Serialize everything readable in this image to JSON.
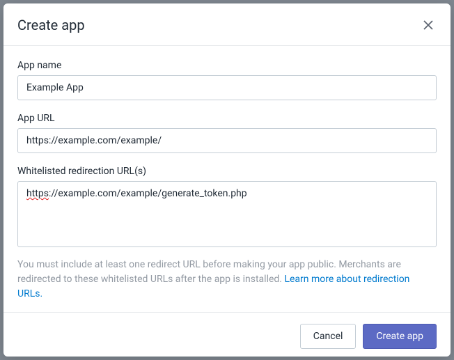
{
  "modal": {
    "title": "Create app",
    "close_label": "Close"
  },
  "form": {
    "app_name": {
      "label": "App name",
      "value": "Example App"
    },
    "app_url": {
      "label": "App URL",
      "value": "https://example.com/example/"
    },
    "whitelisted": {
      "label": "Whitelisted redirection URL(s)",
      "value_prefix": "https",
      "value_suffix": "://example.com/example/generate_token.php"
    },
    "help_text": "You must include at least one redirect URL before making your app public. Merchants are redirected to these whitelisted URLs after the app is installed. ",
    "help_link": "Learn more about redirection URLs."
  },
  "footer": {
    "cancel_label": "Cancel",
    "submit_label": "Create app"
  }
}
